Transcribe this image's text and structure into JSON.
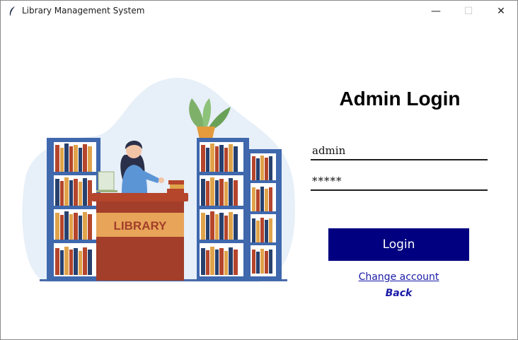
{
  "window": {
    "title": "Library Management System",
    "icon": "feather-icon",
    "controls": {
      "minimize": "—",
      "maximize": "☐",
      "close": "✕"
    }
  },
  "illustration": {
    "icon": "library-illustration",
    "desk_sign": "LIBRARY"
  },
  "form": {
    "heading": "Admin Login",
    "username_value": "admin",
    "password_value": "*****",
    "login_label": "Login",
    "change_account_label": "Change account",
    "back_label": "Back"
  },
  "colors": {
    "login_button": "#000080",
    "link": "#1a1aa6"
  }
}
